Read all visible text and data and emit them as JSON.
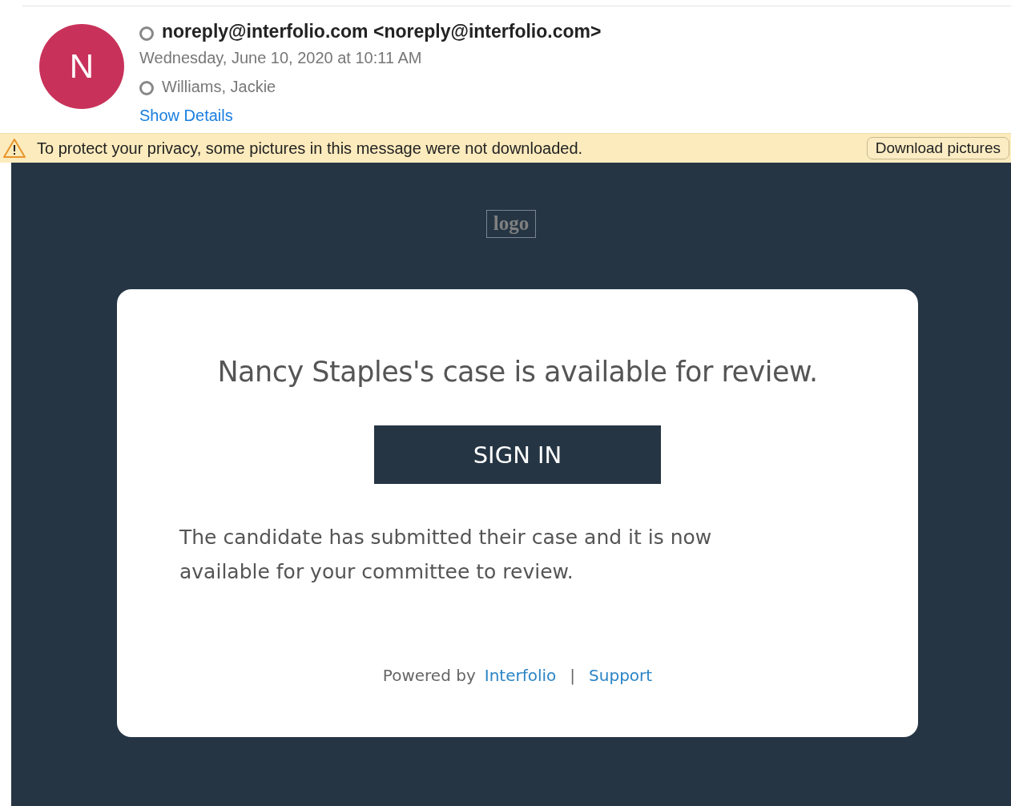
{
  "header": {
    "avatar_letter": "N",
    "sender": "noreply@interfolio.com <noreply@interfolio.com>",
    "date": "Wednesday, June 10, 2020 at 10:11 AM",
    "recipient": "Williams, Jackie",
    "details_link": "Show Details"
  },
  "privacy_banner": {
    "message": "To protect your privacy, some pictures in this message were not downloaded.",
    "button": "Download pictures"
  },
  "email_body": {
    "logo_alt": "logo",
    "heading": "Nancy Staples's case is available for review.",
    "button": "SIGN IN",
    "paragraph": "The candidate has submitted their case and it is now available for your committee to review.",
    "footer": {
      "prefix": "Powered by",
      "link": "Interfolio",
      "separator": "|",
      "support": "Support"
    }
  }
}
